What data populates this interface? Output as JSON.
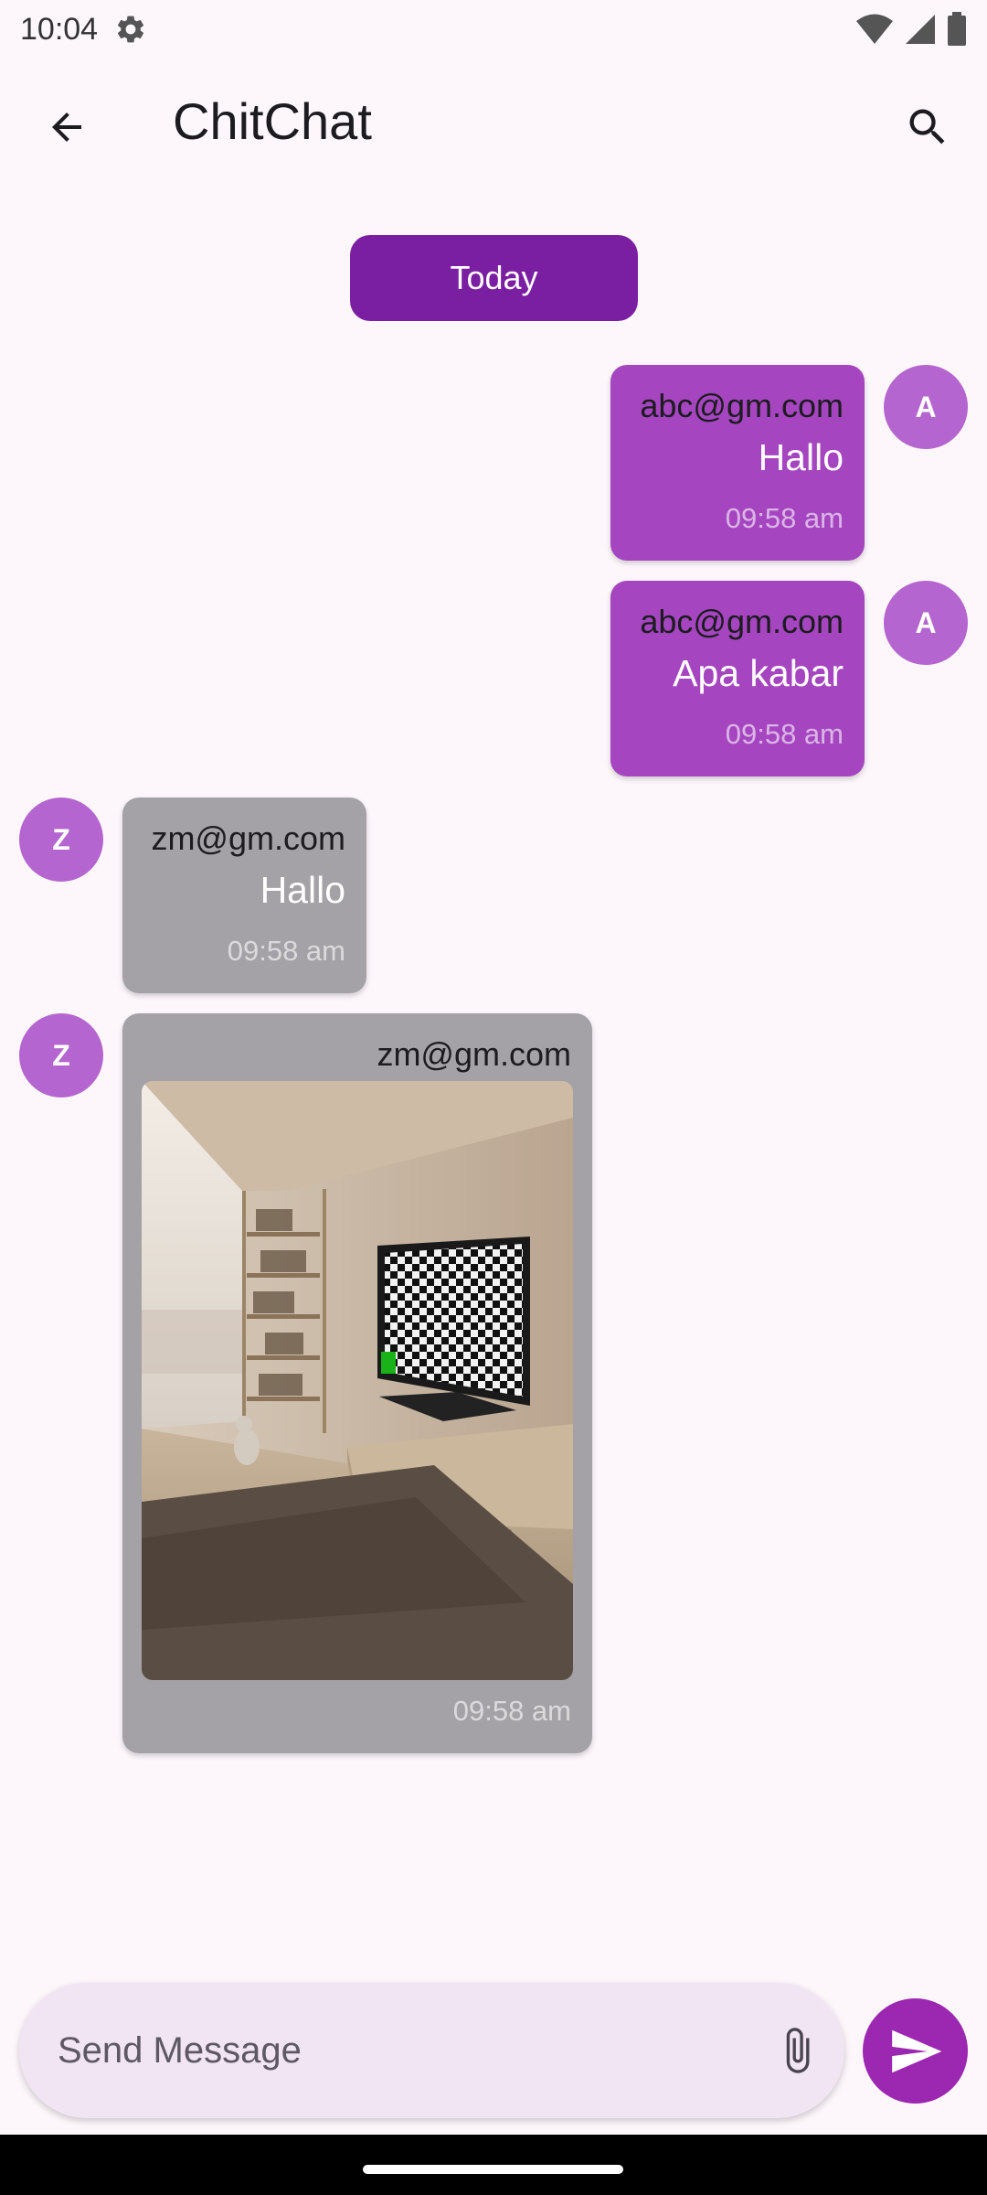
{
  "status_bar": {
    "time": "10:04",
    "icons": [
      "settings-icon",
      "wifi-icon",
      "signal-icon",
      "battery-icon"
    ]
  },
  "app_bar": {
    "title": "ChitChat",
    "back_icon": "arrow-back-icon",
    "search_icon": "search-icon"
  },
  "date_chip": "Today",
  "messages": [
    {
      "side": "sent",
      "avatar": "A",
      "sender": "abc@gm.com",
      "text": "Hallo",
      "time": "09:58 am"
    },
    {
      "side": "sent",
      "avatar": "A",
      "sender": "abc@gm.com",
      "text": "Apa kabar",
      "time": "09:58 am"
    },
    {
      "side": "received",
      "avatar": "Z",
      "sender": "zm@gm.com",
      "text": "Hallo",
      "time": "09:58 am"
    },
    {
      "side": "received",
      "avatar": "Z",
      "sender": "zm@gm.com",
      "image": "photo-living-room-tv",
      "time": "09:58 am"
    }
  ],
  "composer": {
    "placeholder": "Send Message",
    "attach_icon": "paperclip-icon",
    "send_icon": "send-icon"
  },
  "colors": {
    "background": "#fdf7fc",
    "accent": "#7b1fa2",
    "sent_bubble": "#a546c0",
    "received_bubble": "#a4a2a6",
    "avatar": "#b565cf",
    "send_button": "#9c27b0"
  }
}
